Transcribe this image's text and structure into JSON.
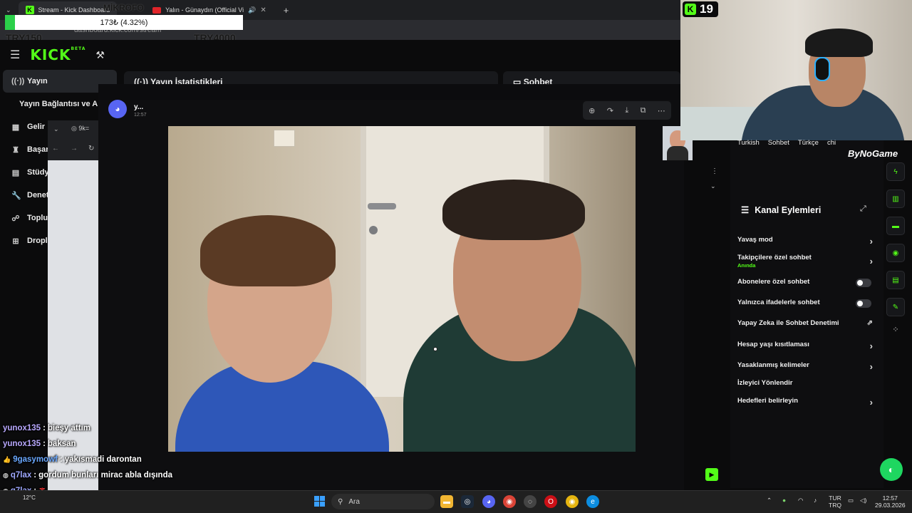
{
  "browser": {
    "tabs": [
      {
        "label": "Stream - Kick Dashboard",
        "active": true
      },
      {
        "label": "Yalın - Günaydın (Official Vi",
        "active": false
      }
    ],
    "new_tab": "+",
    "url": "dashboard.kick.com/stream"
  },
  "overlay": {
    "donation_text": "173₺ (4.32%)",
    "donation_progress": 0.0432,
    "goal_left": "TRY150",
    "goal_right": "TRY4000",
    "top_label": "MİKROFO"
  },
  "kick": {
    "logo": "KICK",
    "beta": "BETA",
    "sidebar": [
      {
        "label": "Yayın",
        "icon": "broadcast-icon",
        "active": true
      },
      {
        "label": "Yayın Bağlantısı ve An",
        "icon": "",
        "active": false
      },
      {
        "label": "Gelir",
        "icon": "chart-icon",
        "active": false
      },
      {
        "label": "Başar",
        "icon": "trophy-icon",
        "active": false
      },
      {
        "label": "Stüdy",
        "icon": "studio-icon",
        "active": false
      },
      {
        "label": "Denet",
        "icon": "wrench-icon",
        "active": false
      },
      {
        "label": "Toplu",
        "icon": "community-icon",
        "active": false
      },
      {
        "label": "Dropla",
        "icon": "drops-icon",
        "active": false
      }
    ],
    "stats_panel": "Yayın İstatistikleri",
    "chat_panel": "Sohbet"
  },
  "discord": {
    "author": "y...",
    "time": "12:57",
    "tools": [
      "zoom-icon",
      "share-icon",
      "download-icon",
      "open-icon",
      "more-icon"
    ]
  },
  "chrome2": {
    "tab_label": "9k="
  },
  "chat_overlay": [
    {
      "user": "yunox135",
      "sep": " :",
      "msg": "bieşy attım",
      "style": "lav"
    },
    {
      "user": "yunox135",
      "sep": " :",
      "msg": "baksan",
      "style": "lav"
    },
    {
      "user": "9gasymowf",
      "sep": " :",
      "msg": "yakısmadi darontan",
      "style": "blue"
    },
    {
      "user": "q7lax",
      "sep": " :",
      "msg": "gordum bunları mirac abla dışında",
      "style": ""
    },
    {
      "user": "q7lax",
      "sep": " :",
      "msg": "",
      "style": ""
    },
    {
      "user": "q7lax",
      "sep": "",
      "msg": "",
      "style": ""
    }
  ],
  "webcam": {
    "kick_count": "19",
    "sponsor": "ByNoGame"
  },
  "stream_tags": [
    "Turkish",
    "Sohbet",
    "Türkçe",
    "chi"
  ],
  "channel_actions": {
    "title": "Kanal Eylemleri",
    "items": [
      {
        "label": "Yavaş mod",
        "control": "arrow"
      },
      {
        "label": "Takipçilere özel sohbet",
        "sub": "Anında",
        "control": "arrow"
      },
      {
        "label": "Abonelere özel sohbet",
        "control": "toggle",
        "on": false
      },
      {
        "label": "Yalnızca ifadelerle sohbet",
        "control": "toggle",
        "on": false
      },
      {
        "label": "Yapay Zeka ile Sohbet Denetimi",
        "control": "external"
      },
      {
        "label": "Hesap yaşı kısıtlaması",
        "control": "arrow"
      },
      {
        "label": "Yasaklanmış kelimeler",
        "control": "arrow"
      },
      {
        "label": "İzleyici Yönlendir",
        "control": "none"
      },
      {
        "label": "Hedefleri belirleyin",
        "control": "arrow"
      }
    ]
  },
  "taskbar": {
    "weather_temp": "12°C",
    "search": "Ara",
    "lang_top": "TUR",
    "lang_bottom": "TRQ",
    "time": "12:57",
    "date": "29.03.2026"
  }
}
